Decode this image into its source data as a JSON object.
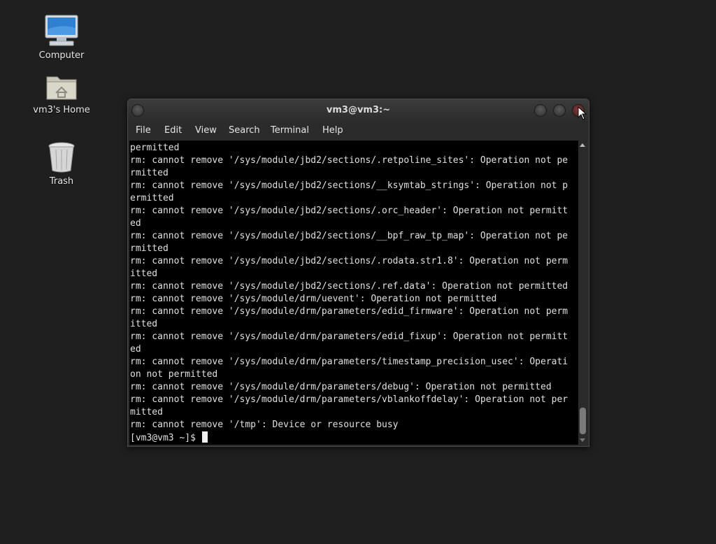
{
  "desktop": {
    "icons": [
      {
        "label": "Computer",
        "icon": "computer-icon"
      },
      {
        "label": "vm3's Home",
        "icon": "home-folder-icon"
      },
      {
        "label": "Trash",
        "icon": "trash-icon"
      }
    ]
  },
  "window": {
    "title": "vm3@vm3:~",
    "menu": [
      "File",
      "Edit",
      "View",
      "Search",
      "Terminal",
      "Help"
    ]
  },
  "terminal": {
    "lines": [
      "permitted",
      "rm: cannot remove '/sys/module/jbd2/sections/.retpoline_sites': Operation not pe",
      "rmitted",
      "rm: cannot remove '/sys/module/jbd2/sections/__ksymtab_strings': Operation not p",
      "ermitted",
      "rm: cannot remove '/sys/module/jbd2/sections/.orc_header': Operation not permitt",
      "ed",
      "rm: cannot remove '/sys/module/jbd2/sections/__bpf_raw_tp_map': Operation not pe",
      "rmitted",
      "rm: cannot remove '/sys/module/jbd2/sections/.rodata.str1.8': Operation not perm",
      "itted",
      "rm: cannot remove '/sys/module/jbd2/sections/.ref.data': Operation not permitted",
      "rm: cannot remove '/sys/module/drm/uevent': Operation not permitted",
      "rm: cannot remove '/sys/module/drm/parameters/edid_firmware': Operation not perm",
      "itted",
      "rm: cannot remove '/sys/module/drm/parameters/edid_fixup': Operation not permitt",
      "ed",
      "rm: cannot remove '/sys/module/drm/parameters/timestamp_precision_usec': Operati",
      "on not permitted",
      "rm: cannot remove '/sys/module/drm/parameters/debug': Operation not permitted",
      "rm: cannot remove '/sys/module/drm/parameters/vblankoffdelay': Operation not per",
      "mitted",
      "rm: cannot remove '/tmp': Device or resource busy"
    ],
    "prompt": "[vm3@vm3 ~]$ "
  },
  "colors": {
    "desktop_bg": "#1f1f1f",
    "terminal_bg": "#000000",
    "terminal_fg": "#e0e0e0"
  }
}
